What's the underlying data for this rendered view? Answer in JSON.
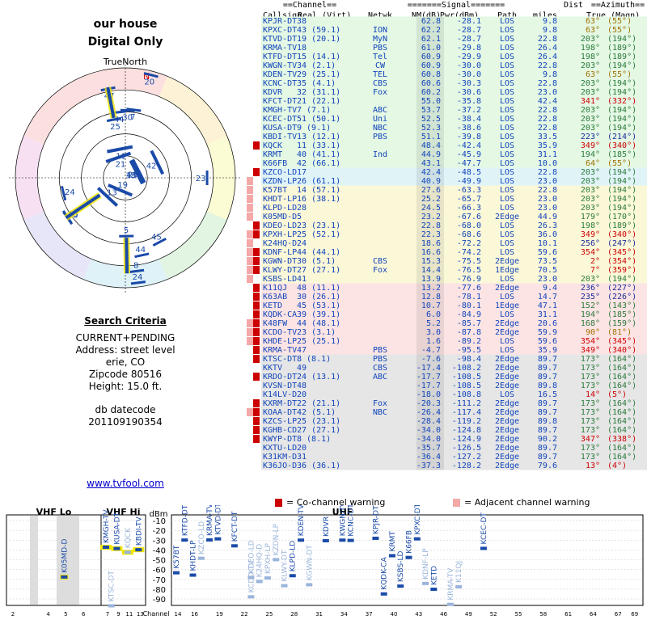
{
  "title": "our house",
  "subtitle": "Digital Only",
  "polar_label": "TrueNorth",
  "north_label": "N",
  "criteria": {
    "heading": "Search Criteria",
    "lines": [
      "CURRENT+PENDING",
      "Address: street level",
      "erie, CO",
      "Zipcode 80516",
      "Height: 15.0 ft."
    ],
    "db_label": "db datecode",
    "db_value": "201109190354"
  },
  "site_link": "www.tvfool.com",
  "table": {
    "group_headers": {
      "channel": "==Channel==",
      "signal": "=======Signal=======",
      "dist": "Dist",
      "azimuth": "==Azimuth=="
    },
    "headers": [
      "Callsign",
      "Real (Virt)",
      "Netwk",
      "NM(dB)",
      "Pwr(dBm)",
      "Path",
      "miles",
      "True (Magn)"
    ],
    "rows": [
      [
        "KPJR-DT",
        "38",
        "",
        "62.8",
        "-28.1",
        "LOS",
        "9.8",
        "63°",
        "(55°)",
        "",
        0
      ],
      [
        "KPXC-DT",
        "43 (59.1)",
        "ION",
        "62.2",
        "-28.7",
        "LOS",
        "9.8",
        "63°",
        "(55°)",
        "",
        0
      ],
      [
        "KTVD-DT",
        "19 (20.1)",
        "MyN",
        "62.1",
        "-28.7",
        "LOS",
        "22.8",
        "203°",
        "(194°)",
        "",
        0
      ],
      [
        "KRMA-TV",
        "18",
        "PBS",
        "61.0",
        "-29.8",
        "LOS",
        "26.4",
        "198°",
        "(189°)",
        "",
        0
      ],
      [
        "KTFD-DT",
        "15 (14.1)",
        "Tel",
        "60.9",
        "-29.9",
        "LOS",
        "26.4",
        "198°",
        "(189°)",
        "",
        0
      ],
      [
        "KWGN-TV",
        "34 (2.1)",
        "CW",
        "60.9",
        "-30.0",
        "LOS",
        "22.8",
        "203°",
        "(194°)",
        "",
        0
      ],
      [
        "KDEN-TV",
        "29 (25.1)",
        "TEL",
        "60.8",
        "-30.0",
        "LOS",
        "9.8",
        "63°",
        "(55°)",
        "",
        0
      ],
      [
        "KCNC-DT",
        "35 (4.1)",
        "CBS",
        "60.6",
        "-30.3",
        "LOS",
        "22.8",
        "203°",
        "(194°)",
        "",
        0
      ],
      [
        "KDVR",
        "32 (31.1)",
        "Fox",
        "60.2",
        "-30.6",
        "LOS",
        "23.0",
        "203°",
        "(194°)",
        "",
        0
      ],
      [
        "KFCT-DT",
        "21 (22.1)",
        "",
        "55.0",
        "-35.8",
        "LOS",
        "42.4",
        "341°",
        "(332°)",
        "",
        0
      ],
      [
        "KMGH-TV",
        "7 (7.1)",
        "ABC",
        "53.7",
        "-37.2",
        "LOS",
        "22.8",
        "203°",
        "(194°)",
        "",
        0
      ],
      [
        "KCEC-DT",
        "51 (50.1)",
        "Uni",
        "52.5",
        "-38.4",
        "LOS",
        "22.8",
        "203°",
        "(194°)",
        "",
        0
      ],
      [
        "KUSA-DT",
        "9 (9.1)",
        "NBC",
        "52.3",
        "-38.6",
        "LOS",
        "22.8",
        "203°",
        "(194°)",
        "",
        0
      ],
      [
        "KBDI-TV",
        "13 (12.1)",
        "PBS",
        "51.1",
        "-39.8",
        "LOS",
        "33.5",
        "223°",
        "(214°)",
        "",
        0
      ],
      [
        "KQCK",
        "11 (33.1)",
        "",
        "48.4",
        "-42.4",
        "LOS",
        "35.9",
        "349°",
        "(340°)",
        "C",
        0
      ],
      [
        "KRMT",
        "40 (41.1)",
        "Ind",
        "44.9",
        "-45.9",
        "LOS",
        "31.1",
        "194°",
        "(185°)",
        "",
        0
      ],
      [
        "K66FB",
        "42 (66.1)",
        "",
        "43.1",
        "-47.7",
        "LOS",
        "10.0",
        "64°",
        "(55°)",
        "",
        0
      ],
      [
        "KZCO-LD",
        "17",
        "",
        "42.4",
        "-48.5",
        "LOS",
        "22.8",
        "203°",
        "(194°)",
        "C",
        1
      ],
      [
        "KZDN-LP",
        "26 (61.1)",
        "",
        "40.9",
        "-49.9",
        "LOS",
        "23.0",
        "203°",
        "(194°)",
        "A",
        1
      ],
      [
        "K57BT",
        "14 (57.1)",
        "",
        "27.6",
        "-63.3",
        "LOS",
        "22.8",
        "203°",
        "(194°)",
        "A",
        2
      ],
      [
        "KHDT-LP",
        "16 (38.1)",
        "",
        "25.2",
        "-65.7",
        "LOS",
        "23.0",
        "203°",
        "(194°)",
        "A",
        2
      ],
      [
        "KLPD-LD",
        "28",
        "",
        "24.5",
        "-66.3",
        "LOS",
        "23.0",
        "203°",
        "(194°)",
        "A",
        2
      ],
      [
        "K05MD-D",
        "5",
        "",
        "23.2",
        "-67.6",
        "2Edge",
        "44.9",
        "179°",
        "(170°)",
        "A",
        2
      ],
      [
        "KDEO-LD",
        "23 (23.1)",
        "",
        "22.8",
        "-68.0",
        "LOS",
        "26.3",
        "198°",
        "(189°)",
        "C",
        2
      ],
      [
        "KPXH-LP",
        "25 (52.1)",
        "",
        "22.3",
        "-68.6",
        "LOS",
        "36.0",
        "349°",
        "(340°)",
        "AC",
        2
      ],
      [
        "K24HQ-D",
        "24",
        "",
        "18.6",
        "-72.2",
        "LOS",
        "10.1",
        "256°",
        "(247°)",
        "A",
        2
      ],
      [
        "KDNF-LP",
        "44 (44.1)",
        "",
        "16.6",
        "-74.2",
        "LOS",
        "59.6",
        "354°",
        "(345°)",
        "AC",
        2
      ],
      [
        "KGWN-DT",
        "30 (5.1)",
        "CBS",
        "15.3",
        "-75.5",
        "2Edge",
        "73.5",
        "2°",
        "(354°)",
        "AC",
        2
      ],
      [
        "KLWY-DT",
        "27 (27.1)",
        "Fox",
        "14.4",
        "-76.5",
        "1Edge",
        "70.5",
        "7°",
        "(359°)",
        "AC",
        2
      ],
      [
        "KSBS-LD",
        "41",
        "",
        "13.9",
        "-76.9",
        "LOS",
        "23.0",
        "203°",
        "(194°)",
        "A",
        2
      ],
      [
        "K11QJ",
        "48 (11.1)",
        "",
        "13.2",
        "-77.6",
        "2Edge",
        "9.4",
        "236°",
        "(227°)",
        "C",
        3
      ],
      [
        "K63AB",
        "30 (26.1)",
        "",
        "12.8",
        "-78.1",
        "LOS",
        "14.7",
        "235°",
        "(226°)",
        "C",
        3
      ],
      [
        "KETD",
        "45 (53.1)",
        "",
        "10.7",
        "-80.1",
        "1Edge",
        "47.1",
        "152°",
        "(143°)",
        "C",
        3
      ],
      [
        "KQDK-CA",
        "39 (39.1)",
        "",
        "6.0",
        "-84.9",
        "LOS",
        "31.1",
        "194°",
        "(185°)",
        "C",
        3
      ],
      [
        "K48FW",
        "44 (48.1)",
        "",
        "5.2",
        "-85.7",
        "2Edge",
        "20.6",
        "168°",
        "(159°)",
        "AC",
        3
      ],
      [
        "KCDO-TV",
        "23 (3.1)",
        "",
        "3.0",
        "-87.8",
        "2Edge",
        "59.9",
        "90°",
        "(81°)",
        "AC",
        3
      ],
      [
        "KHDE-LP",
        "25 (25.1)",
        "",
        "1.6",
        "-89.2",
        "LOS",
        "59.6",
        "354°",
        "(345°)",
        "AC",
        3
      ],
      [
        "KRMA-TV",
        "47",
        "PBS",
        "-4.7",
        "-95.5",
        "LOS",
        "35.9",
        "349°",
        "(340°)",
        "C",
        3
      ],
      [
        "KTSC-DT",
        "8 (8.1)",
        "PBS",
        "-7.6",
        "-98.4",
        "2Edge",
        "89.7",
        "173°",
        "(164°)",
        "C",
        4
      ],
      [
        "KKTV",
        "49",
        "CBS",
        "-17.4",
        "-108.2",
        "2Edge",
        "89.7",
        "173°",
        "(164°)",
        "",
        4
      ],
      [
        "KRDO-DT",
        "24 (13.1)",
        "ABC",
        "-17.7",
        "-108.5",
        "2Edge",
        "89.7",
        "173°",
        "(164°)",
        "C",
        4
      ],
      [
        "KVSN-DT",
        "48",
        "",
        "-17.7",
        "-108.5",
        "2Edge",
        "89.8",
        "173°",
        "(164°)",
        "",
        4
      ],
      [
        "K14LV-D",
        "20",
        "",
        "-18.0",
        "-108.8",
        "LOS",
        "16.5",
        "14°",
        "(5°)",
        "",
        4
      ],
      [
        "KXRM-DT",
        "22 (21.1)",
        "Fox",
        "-20.3",
        "-111.2",
        "2Edge",
        "89.7",
        "173°",
        "(164°)",
        "C",
        4
      ],
      [
        "KOAA-DT",
        "42 (5.1)",
        "NBC",
        "-26.4",
        "-117.4",
        "2Edge",
        "89.7",
        "173°",
        "(164°)",
        "AC",
        4
      ],
      [
        "KZCS-LP",
        "25 (23.1)",
        "",
        "-28.4",
        "-119.2",
        "2Edge",
        "89.8",
        "173°",
        "(164°)",
        "C",
        4
      ],
      [
        "KGHB-CD",
        "27 (27.1)",
        "",
        "-34.0",
        "-124.8",
        "2Edge",
        "89.7",
        "173°",
        "(164°)",
        "C",
        4
      ],
      [
        "KWYP-DT",
        "8 (8.1)",
        "",
        "-34.0",
        "-124.9",
        "2Edge",
        "90.2",
        "347°",
        "(338°)",
        "C",
        4
      ],
      [
        "KXTU-LD",
        "20",
        "",
        "-35.7",
        "-126.5",
        "2Edge",
        "89.7",
        "173°",
        "(164°)",
        "",
        4
      ],
      [
        "K31KM-D",
        "31",
        "",
        "-36.4",
        "-127.2",
        "2Edge",
        "89.7",
        "173°",
        "(164°)",
        "",
        4
      ],
      [
        "K36JO-D",
        "36 (36.1)",
        "",
        "-37.3",
        "-128.2",
        "2Edge",
        "79.6",
        "13°",
        "(4°)",
        "",
        4
      ]
    ]
  },
  "legend": {
    "co": "= Co-channel warning",
    "adj": "= Adjacent channel warning"
  },
  "chart_data": [
    {
      "type": "polar",
      "stations": [
        {
          "label": "47",
          "az": 349,
          "nm": -4.7
        },
        {
          "label": "25",
          "az": 349,
          "nm": 22.3
        },
        {
          "label": "44",
          "az": 354,
          "nm": 16.6
        },
        {
          "label": "11",
          "az": 349,
          "nm": 48.4
        },
        {
          "label": "20",
          "az": 14,
          "nm": -18.0
        },
        {
          "label": "30",
          "az": 2,
          "nm": 15.3
        },
        {
          "label": "7",
          "az": 7,
          "nm": 14.4
        },
        {
          "label": "21",
          "az": 341,
          "nm": 55.0
        },
        {
          "label": "38",
          "az": 63,
          "nm": 62.8
        },
        {
          "label": "43",
          "az": 63,
          "nm": 62.2
        },
        {
          "label": "29",
          "az": 63,
          "nm": 60.8
        },
        {
          "label": "42",
          "az": 64,
          "nm": 43.1
        },
        {
          "label": "23",
          "az": 90,
          "nm": 3.0
        },
        {
          "label": "24",
          "az": 256,
          "nm": 18.6
        },
        {
          "label": "48",
          "az": 236,
          "nm": 13.2
        },
        {
          "label": "30",
          "az": 235,
          "nm": 12.8
        },
        {
          "label": "13",
          "az": 223,
          "nm": 51.1
        },
        {
          "label": "19",
          "az": 203,
          "nm": 62.1
        },
        {
          "label": "45",
          "az": 152,
          "nm": 10.7
        },
        {
          "label": "44",
          "az": 168,
          "nm": 5.2
        },
        {
          "label": "5",
          "az": 179,
          "nm": 23.2
        },
        {
          "label": "8",
          "az": 173,
          "nm": -7.6
        },
        {
          "label": "24",
          "az": 173,
          "nm": -17.7
        }
      ]
    },
    {
      "type": "bar",
      "title": "",
      "ylabel": "dBm",
      "xlabel": "Channel",
      "ylim": [
        -90,
        -10
      ],
      "yticks": [
        -10,
        -20,
        -30,
        -40,
        -50,
        -60,
        -70,
        -80,
        -90
      ],
      "bands": [
        {
          "name": "VHF Lo",
          "x_ticks": [
            2,
            4,
            5,
            6
          ]
        },
        {
          "name": "VHF Hi",
          "x_ticks": [
            7,
            9,
            11,
            13
          ]
        },
        {
          "name": "UHF",
          "x_ticks": [
            14,
            16,
            19,
            22,
            25,
            28,
            31,
            34,
            37,
            40,
            43,
            46,
            49,
            52,
            55,
            58,
            61,
            64,
            67,
            69
          ]
        }
      ],
      "stations": [
        {
          "callsign": "K05MD-D",
          "channel": 5,
          "pwr": -67.6,
          "strong": true
        },
        {
          "callsign": "KMGH-TV",
          "channel": 7,
          "pwr": -37.2,
          "strong": true
        },
        {
          "callsign": "KTSC-DT",
          "channel": 8,
          "pwr": -98.4,
          "strong": false
        },
        {
          "callsign": "KUSA-DT",
          "channel": 9,
          "pwr": -38.6,
          "strong": true
        },
        {
          "callsign": "KQCK",
          "channel": 11,
          "pwr": -42.4,
          "strong": false
        },
        {
          "callsign": "KBDI-TV",
          "channel": 13,
          "pwr": -39.8,
          "strong": true
        },
        {
          "callsign": "K57BT",
          "channel": 14,
          "pwr": -63.3,
          "strong": true
        },
        {
          "callsign": "KTFD-DT",
          "channel": 15,
          "pwr": -29.9,
          "strong": true
        },
        {
          "callsign": "KHDT-LP",
          "channel": 16,
          "pwr": -65.7,
          "strong": true
        },
        {
          "callsign": "KZCO-LD",
          "channel": 17,
          "pwr": -48.5,
          "strong": false
        },
        {
          "callsign": "KRMA-TV",
          "channel": 18,
          "pwr": -29.8,
          "strong": true
        },
        {
          "callsign": "KTVD-DT",
          "channel": 19,
          "pwr": -28.7,
          "strong": true
        },
        {
          "callsign": "KFCT-DT",
          "channel": 21,
          "pwr": -35.8,
          "strong": true
        },
        {
          "callsign": "KCDO-TV",
          "channel": 23,
          "pwr": -87.8,
          "strong": false
        },
        {
          "callsign": "KDEO-LD",
          "channel": 23,
          "pwr": -68.0,
          "strong": false
        },
        {
          "callsign": "K24HQ-D",
          "channel": 24,
          "pwr": -72.2,
          "strong": false
        },
        {
          "callsign": "KPXH-LP",
          "channel": 25,
          "pwr": -68.6,
          "strong": false
        },
        {
          "callsign": "KZDN-LP",
          "channel": 26,
          "pwr": -49.9,
          "strong": false
        },
        {
          "callsign": "KLWY-DT",
          "channel": 27,
          "pwr": -76.5,
          "strong": false
        },
        {
          "callsign": "KLPD-LD",
          "channel": 28,
          "pwr": -66.3,
          "strong": true
        },
        {
          "callsign": "KDEN-TV",
          "channel": 29,
          "pwr": -30.0,
          "strong": true
        },
        {
          "callsign": "KGWN-DT",
          "channel": 30,
          "pwr": -75.5,
          "strong": false
        },
        {
          "callsign": "KDVR",
          "channel": 32,
          "pwr": -30.6,
          "strong": true
        },
        {
          "callsign": "KWGN-TV",
          "channel": 34,
          "pwr": -30.0,
          "strong": true
        },
        {
          "callsign": "KCNC-DT",
          "channel": 35,
          "pwr": -30.3,
          "strong": true
        },
        {
          "callsign": "KPJR-DT",
          "channel": 38,
          "pwr": -28.1,
          "strong": true
        },
        {
          "callsign": "KQDK-CA",
          "channel": 39,
          "pwr": -84.9,
          "strong": true
        },
        {
          "callsign": "KRMT",
          "channel": 40,
          "pwr": -45.9,
          "strong": true
        },
        {
          "callsign": "KSBS-LD",
          "channel": 41,
          "pwr": -76.9,
          "strong": true
        },
        {
          "callsign": "K66FB",
          "channel": 42,
          "pwr": -47.7,
          "strong": true
        },
        {
          "callsign": "KPXC-DT",
          "channel": 43,
          "pwr": -28.7,
          "strong": true
        },
        {
          "callsign": "KDNF-LP",
          "channel": 44,
          "pwr": -74.2,
          "strong": false
        },
        {
          "callsign": "KETD",
          "channel": 45,
          "pwr": -80.1,
          "strong": true
        },
        {
          "callsign": "KRMA-TV",
          "channel": 47,
          "pwr": -95.5,
          "strong": false
        },
        {
          "callsign": "K11QJ",
          "channel": 48,
          "pwr": -77.6,
          "strong": false
        },
        {
          "callsign": "KCEC-DT",
          "channel": 51,
          "pwr": -38.4,
          "strong": true
        }
      ]
    }
  ],
  "colors": {
    "green_row": "#e4f8e4",
    "cyan_row": "#e0f4f8",
    "yellow_row": "#fbf8d8",
    "pink_row": "#fce4e4",
    "gray_row": "#e6e6e6",
    "callsign": "#1144bb",
    "warn_red": "#cc0000",
    "bar": "#1a4aa8"
  }
}
